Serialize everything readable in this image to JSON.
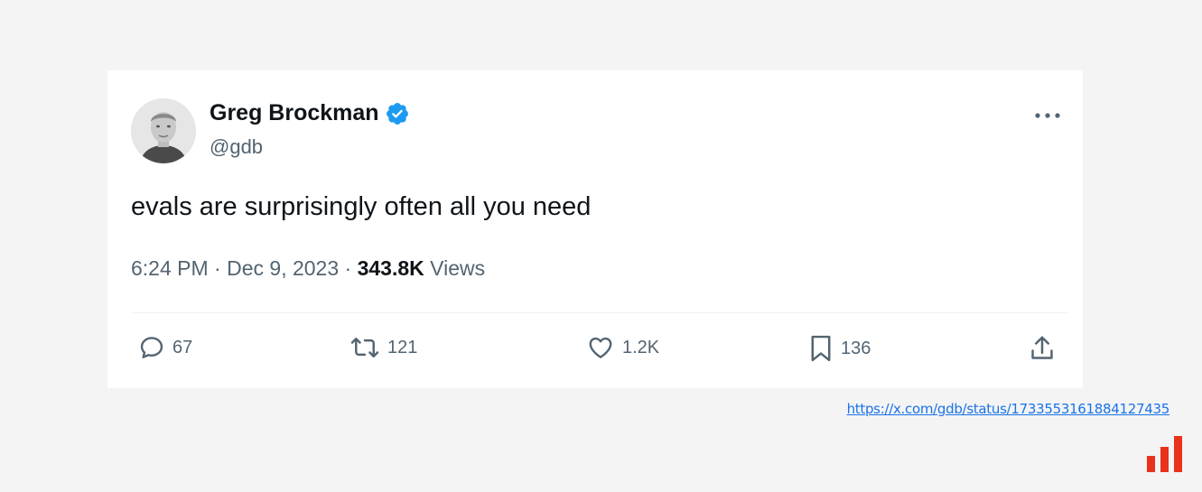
{
  "tweet": {
    "author": {
      "name": "Greg Brockman",
      "handle": "@gdb",
      "verified": true
    },
    "text": "evals are surprisingly often all you need",
    "time": "6:24 PM",
    "separator": "·",
    "date": "Dec 9, 2023",
    "views_count": "343.8K",
    "views_label": "Views",
    "actions": {
      "replies": "67",
      "reposts": "121",
      "likes": "1.2K",
      "bookmarks": "136"
    }
  },
  "source_url": "https://x.com/gdb/status/1733553161884127435",
  "colors": {
    "verified": "#1d9bf0",
    "muted": "#536471",
    "text": "#0f1419",
    "link": "#1a73e8",
    "logo": "#e8321c"
  },
  "icons": [
    "verified-icon",
    "more-icon",
    "reply-icon",
    "repost-icon",
    "like-icon",
    "bookmark-icon",
    "share-icon"
  ]
}
